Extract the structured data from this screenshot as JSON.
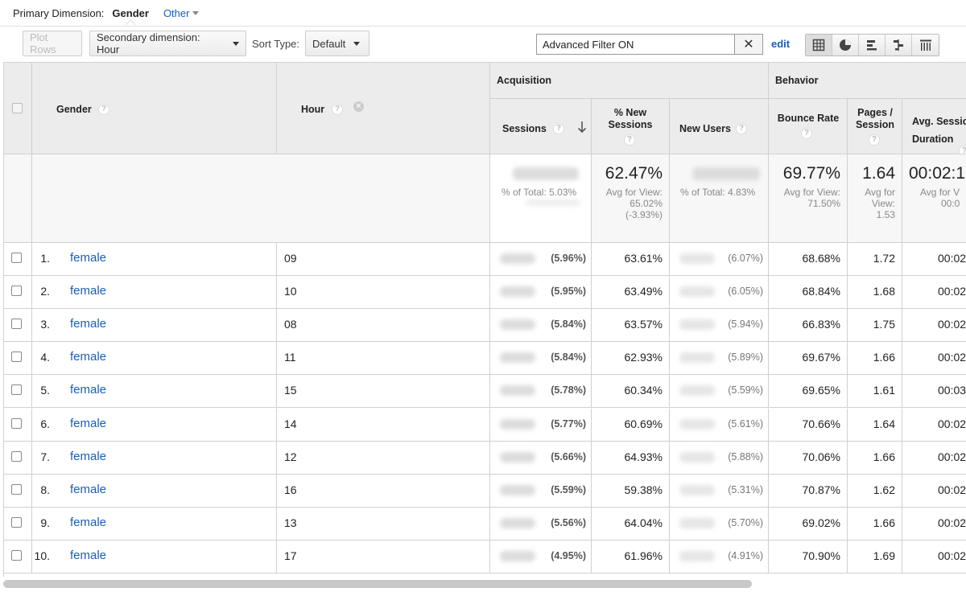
{
  "primary_dimension": {
    "label": "Primary Dimension:",
    "active": "Gender",
    "other": "Other"
  },
  "toolbar": {
    "plot_rows": "Plot Rows",
    "secondary_dimension": "Secondary dimension: Hour",
    "sort_type_label": "Sort Type:",
    "sort_type_value": "Default",
    "filter_text": "Advanced Filter ON",
    "filter_clear": "✕",
    "edit": "edit",
    "view_icons": [
      "data-table-icon",
      "pie-chart-icon",
      "performance-bars-icon",
      "comparison-icon",
      "pivot-icon"
    ]
  },
  "table": {
    "groups": {
      "acquisition": "Acquisition",
      "behavior": "Behavior"
    },
    "headers": {
      "gender": "Gender",
      "hour": "Hour",
      "sessions": "Sessions",
      "new_sessions": "% New Sessions",
      "new_users": "New Users",
      "bounce_rate": "Bounce Rate",
      "pages_session": "Pages / Session",
      "avg_duration": "Avg. Session Duration"
    },
    "summary": {
      "sessions_sub": "% of Total: 5.03%",
      "new_sessions_big": "62.47%",
      "new_sessions_sub1": "Avg for View:",
      "new_sessions_sub2": "65.02%",
      "new_sessions_sub3": "(-3.93%)",
      "new_users_sub": "% of Total: 4.83%",
      "bounce_big": "69.77%",
      "bounce_sub1": "Avg for View:",
      "bounce_sub2": "71.50%",
      "pages_big": "1.64",
      "pages_sub1": "Avg for",
      "pages_sub2": "View:",
      "pages_sub3": "1.53",
      "duration_big": "00:02:1",
      "duration_sub1": "Avg for V",
      "duration_sub2": "00:0"
    },
    "rows": [
      {
        "num": "1.",
        "gender": "female",
        "hour": "09",
        "sessions_pct": "(5.96%)",
        "new_sessions": "63.61%",
        "new_users_pct": "(6.07%)",
        "bounce": "68.68%",
        "pages": "1.72",
        "duration": "00:02"
      },
      {
        "num": "2.",
        "gender": "female",
        "hour": "10",
        "sessions_pct": "(5.95%)",
        "new_sessions": "63.49%",
        "new_users_pct": "(6.05%)",
        "bounce": "68.84%",
        "pages": "1.68",
        "duration": "00:02"
      },
      {
        "num": "3.",
        "gender": "female",
        "hour": "08",
        "sessions_pct": "(5.84%)",
        "new_sessions": "63.57%",
        "new_users_pct": "(5.94%)",
        "bounce": "66.83%",
        "pages": "1.75",
        "duration": "00:02"
      },
      {
        "num": "4.",
        "gender": "female",
        "hour": "11",
        "sessions_pct": "(5.84%)",
        "new_sessions": "62.93%",
        "new_users_pct": "(5.89%)",
        "bounce": "69.67%",
        "pages": "1.66",
        "duration": "00:02"
      },
      {
        "num": "5.",
        "gender": "female",
        "hour": "15",
        "sessions_pct": "(5.78%)",
        "new_sessions": "60.34%",
        "new_users_pct": "(5.59%)",
        "bounce": "69.65%",
        "pages": "1.61",
        "duration": "00:03"
      },
      {
        "num": "6.",
        "gender": "female",
        "hour": "14",
        "sessions_pct": "(5.77%)",
        "new_sessions": "60.69%",
        "new_users_pct": "(5.61%)",
        "bounce": "70.66%",
        "pages": "1.64",
        "duration": "00:02"
      },
      {
        "num": "7.",
        "gender": "female",
        "hour": "12",
        "sessions_pct": "(5.66%)",
        "new_sessions": "64.93%",
        "new_users_pct": "(5.88%)",
        "bounce": "70.06%",
        "pages": "1.66",
        "duration": "00:02"
      },
      {
        "num": "8.",
        "gender": "female",
        "hour": "16",
        "sessions_pct": "(5.59%)",
        "new_sessions": "59.38%",
        "new_users_pct": "(5.31%)",
        "bounce": "70.87%",
        "pages": "1.62",
        "duration": "00:02"
      },
      {
        "num": "9.",
        "gender": "female",
        "hour": "13",
        "sessions_pct": "(5.56%)",
        "new_sessions": "64.04%",
        "new_users_pct": "(5.70%)",
        "bounce": "69.02%",
        "pages": "1.66",
        "duration": "00:02"
      },
      {
        "num": "10.",
        "gender": "female",
        "hour": "17",
        "sessions_pct": "(4.95%)",
        "new_sessions": "61.96%",
        "new_users_pct": "(4.91%)",
        "bounce": "70.90%",
        "pages": "1.69",
        "duration": "00:02"
      }
    ]
  }
}
